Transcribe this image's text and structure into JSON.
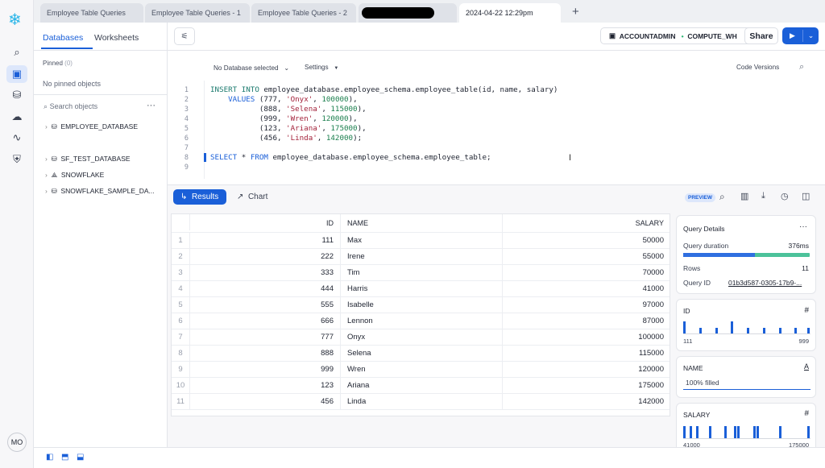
{
  "tabs": [
    "Employee Table Queries",
    "Employee Table Queries - 1",
    "Employee Table Queries - 2",
    "",
    "2024-04-22 12:29pm"
  ],
  "add_tab": "+",
  "rail": {
    "avatar": "MO"
  },
  "dbpanel": {
    "tab_databases": "Databases",
    "tab_worksheets": "Worksheets",
    "pinned_label": "Pinned",
    "pinned_count": "(0)",
    "no_pinned": "No pinned objects",
    "search_placeholder": "Search objects",
    "more": "···",
    "databases": [
      "EMPLOYEE_DATABASE",
      "SF_TEST_DATABASE",
      "SNOWFLAKE",
      "SNOWFLAKE_SAMPLE_DA..."
    ]
  },
  "toolbar": {
    "role": "ACCOUNTADMIN",
    "warehouse": "COMPUTE_WH",
    "share": "Share"
  },
  "editor": {
    "db_select": "No Database selected",
    "settings": "Settings",
    "code_versions": "Code Versions",
    "line_numbers": [
      "1",
      "2",
      "3",
      "4",
      "5",
      "6",
      "7",
      "8",
      "9"
    ]
  },
  "results": {
    "results_tab": "Results",
    "chart_tab": "Chart",
    "preview_badge": "PREVIEW",
    "columns": [
      "ID",
      "NAME",
      "SALARY"
    ],
    "rows": [
      [
        "1",
        "111",
        "Max",
        "50000"
      ],
      [
        "2",
        "222",
        "Irene",
        "55000"
      ],
      [
        "3",
        "333",
        "Tim",
        "70000"
      ],
      [
        "4",
        "444",
        "Harris",
        "41000"
      ],
      [
        "5",
        "555",
        "Isabelle",
        "97000"
      ],
      [
        "6",
        "666",
        "Lennon",
        "87000"
      ],
      [
        "7",
        "777",
        "Onyx",
        "100000"
      ],
      [
        "8",
        "888",
        "Selena",
        "115000"
      ],
      [
        "9",
        "999",
        "Wren",
        "120000"
      ],
      [
        "10",
        "123",
        "Ariana",
        "175000"
      ],
      [
        "11",
        "456",
        "Linda",
        "142000"
      ]
    ]
  },
  "details": {
    "title": "Query Details",
    "more": "···",
    "duration_label": "Query duration",
    "duration": "376ms",
    "duration_split": 0.57,
    "rows_label": "Rows",
    "rows": "11",
    "qid_label": "Query ID",
    "qid": "01b3d587-0305-17b9-...",
    "id_card": {
      "name": "ID",
      "type_icon": "#",
      "min": "111",
      "max": "999"
    },
    "name_card": {
      "name": "NAME",
      "type_icon": "A",
      "filled": "100% filled"
    },
    "salary_card": {
      "name": "SALARY",
      "type_icon": "#",
      "min": "41000",
      "max": "175000"
    }
  },
  "colors": {
    "accent": "#1a5fd8",
    "green": "#4cc29a"
  }
}
